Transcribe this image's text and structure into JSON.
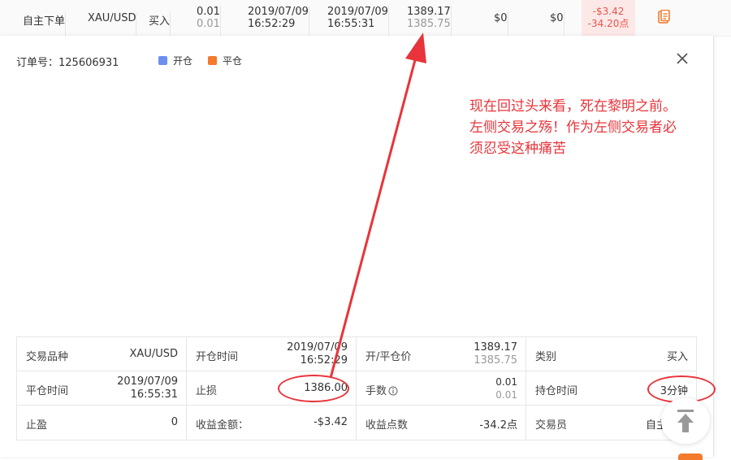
{
  "background_row": {
    "type": "自主下单",
    "symbol": "XAU/USD",
    "side": "买入",
    "lots": [
      "0.01",
      "0.01"
    ],
    "open_time": [
      "2019/07/09",
      "16:52:29"
    ],
    "close_time": [
      "2019/07/09",
      "16:55:31"
    ],
    "prices": [
      "1389.17",
      "1385.75"
    ],
    "fee_a": "$0",
    "fee_b": "$0",
    "pnl": [
      "-$3.42",
      "-34.20点"
    ]
  },
  "modal": {
    "order_label": "订单号：125606931",
    "legend": [
      {
        "label": "开仓",
        "color": "#6d8ff0"
      },
      {
        "label": "平仓",
        "color": "#f37b2b"
      }
    ]
  },
  "annotation": {
    "lines": [
      "现在回过头来看，死在黎明之前。",
      "左侧交易之殇！作为左侧交易者必",
      "须忍受这种痛苦"
    ],
    "color": "#e8343a"
  },
  "details": {
    "rows": [
      [
        {
          "label": "交易品种",
          "value": [
            "XAU/USD"
          ]
        },
        {
          "label": "开仓时间",
          "value": [
            "2019/07/09",
            "16:52:29"
          ]
        },
        {
          "label": "开/平仓价",
          "value": [
            "1389.17",
            "1385.75"
          ]
        },
        {
          "label": "类别",
          "value": [
            "买入"
          ]
        }
      ],
      [
        {
          "label": "平仓时间",
          "value": [
            "2019/07/09",
            "16:55:31"
          ]
        },
        {
          "label": "止损",
          "value": [
            "1386.00"
          ]
        },
        {
          "label": "手数",
          "value": [
            "0.01",
            "0.01"
          ]
        },
        {
          "label": "持仓时间",
          "value": [
            "3分钟"
          ]
        }
      ],
      [
        {
          "label": "止盈",
          "value": [
            "0"
          ]
        },
        {
          "label": "收益金额：",
          "value": [
            "-$3.42"
          ]
        },
        {
          "label": "收益点数",
          "value": [
            "-34.2点"
          ]
        },
        {
          "label": "交易员",
          "value": [
            "自主"
          ]
        }
      ]
    ]
  },
  "colors": {
    "loss": "#e8564b",
    "annotation": "#e8343a",
    "accent": "#f37b2b"
  }
}
